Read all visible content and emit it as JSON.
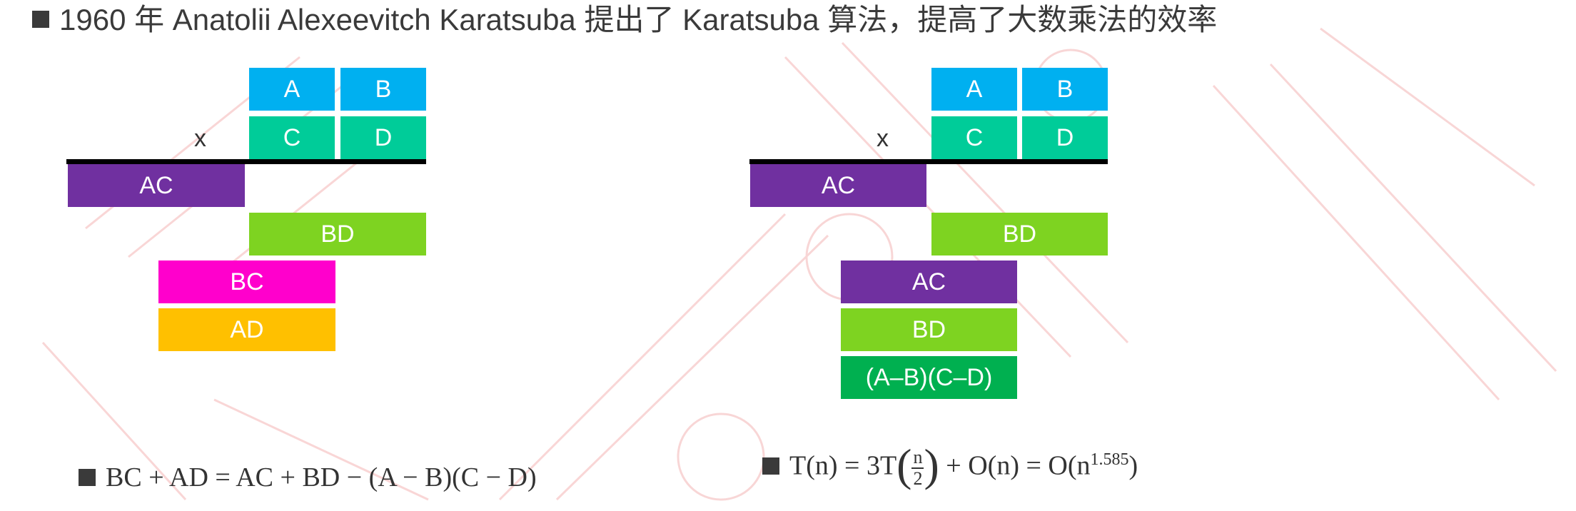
{
  "title": "1960 年 Anatolii Alexeevitch Karatsuba 提出了 Karatsuba 算法，提高了大数乘法的效率",
  "colors": {
    "blue": "#00b0f0",
    "teal": "#00cc99",
    "purple": "#7030a0",
    "green": "#7ed321",
    "magenta": "#ff00cc",
    "orange": "#ffc000",
    "darkgreen": "#00b050"
  },
  "left_diagram": {
    "top_row": [
      "A",
      "B"
    ],
    "second_row": [
      "C",
      "D"
    ],
    "times": "x",
    "products": [
      "AC",
      "BD",
      "BC",
      "AD"
    ]
  },
  "right_diagram": {
    "top_row": [
      "A",
      "B"
    ],
    "second_row": [
      "C",
      "D"
    ],
    "times": "x",
    "products": [
      "AC",
      "BD",
      "AC",
      "BD",
      "(A–B)(C–D)"
    ]
  },
  "formula_left": {
    "text": "BC + AD = AC + BD  − (A − B)(C − D)"
  },
  "formula_right": {
    "prefix": "T(n) = 3T",
    "frac_num": "n",
    "frac_den": "2",
    "middle": " + O(n) = O(n",
    "exponent": "1.585",
    "suffix": ")"
  }
}
